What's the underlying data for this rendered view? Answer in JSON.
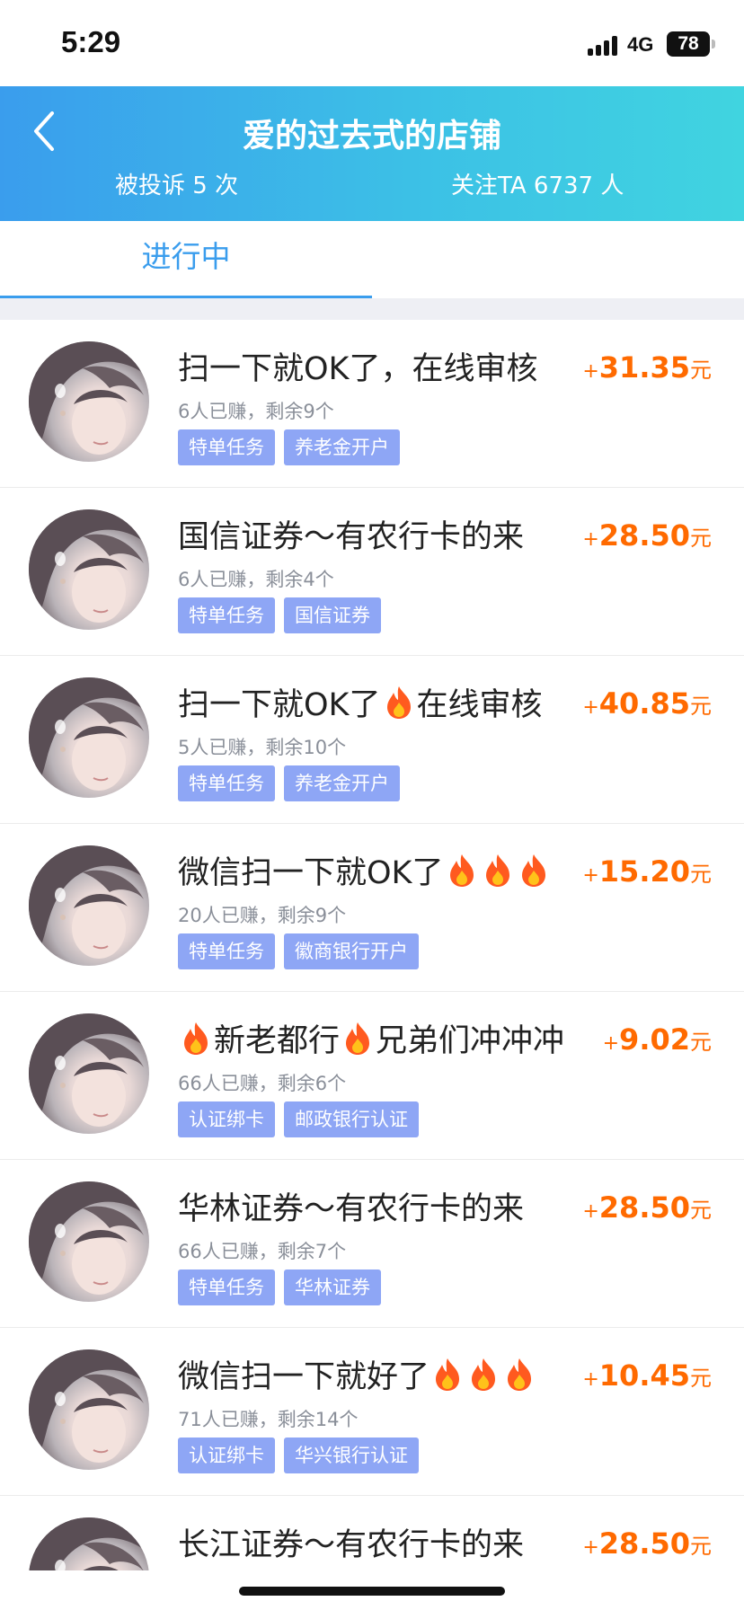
{
  "status_bar": {
    "time": "5:29",
    "network": "4G",
    "battery": "78"
  },
  "header": {
    "title": "爱的过去式的店铺",
    "complaints": "被投诉 5 次",
    "followers": "关注TA 6737 人"
  },
  "tabs": [
    {
      "label": "进行中",
      "active": true
    }
  ],
  "colors": {
    "header_start": "#3a9ded",
    "header_end": "#40d4e0",
    "tag_bg": "#8ea6f5",
    "reward": "#ff6a00"
  },
  "tasks": [
    {
      "title_parts": [
        "扫一下就OK了，在线审核"
      ],
      "stats": "6人已赚，剩余9个",
      "tags": [
        "特单任务",
        "养老金开户"
      ],
      "reward_plus": "+",
      "reward_amount": "31.35",
      "reward_unit": "元"
    },
    {
      "title_parts": [
        "国信证券～有农行卡的来"
      ],
      "stats": "6人已赚，剩余4个",
      "tags": [
        "特单任务",
        "国信证券"
      ],
      "reward_plus": "+",
      "reward_amount": "28.50",
      "reward_unit": "元"
    },
    {
      "title_parts": [
        "扫一下就OK了",
        "fire-icon",
        "在线审核"
      ],
      "stats": "5人已赚，剩余10个",
      "tags": [
        "特单任务",
        "养老金开户"
      ],
      "reward_plus": "+",
      "reward_amount": "40.85",
      "reward_unit": "元"
    },
    {
      "title_parts": [
        "微信扫一下就OK了",
        "fire-icon",
        "fire-icon",
        "fire-icon"
      ],
      "stats": "20人已赚，剩余9个",
      "tags": [
        "特单任务",
        "徽商银行开户"
      ],
      "reward_plus": "+",
      "reward_amount": "15.20",
      "reward_unit": "元"
    },
    {
      "title_parts": [
        "fire-icon",
        "新老都行",
        "fire-icon",
        "兄弟们冲冲冲"
      ],
      "stats": "66人已赚，剩余6个",
      "tags": [
        "认证绑卡",
        "邮政银行认证"
      ],
      "reward_plus": "+",
      "reward_amount": "9.02",
      "reward_unit": "元"
    },
    {
      "title_parts": [
        "华林证券～有农行卡的来"
      ],
      "stats": "66人已赚，剩余7个",
      "tags": [
        "特单任务",
        "华林证券"
      ],
      "reward_plus": "+",
      "reward_amount": "28.50",
      "reward_unit": "元"
    },
    {
      "title_parts": [
        "微信扫一下就好了",
        "fire-icon",
        "fire-icon",
        "fire-icon"
      ],
      "stats": "71人已赚，剩余14个",
      "tags": [
        "认证绑卡",
        "华兴银行认证"
      ],
      "reward_plus": "+",
      "reward_amount": "10.45",
      "reward_unit": "元"
    },
    {
      "title_parts": [
        "长江证券～有农行卡的来"
      ],
      "stats": "",
      "tags": [],
      "reward_plus": "+",
      "reward_amount": "28.50",
      "reward_unit": "元"
    }
  ]
}
